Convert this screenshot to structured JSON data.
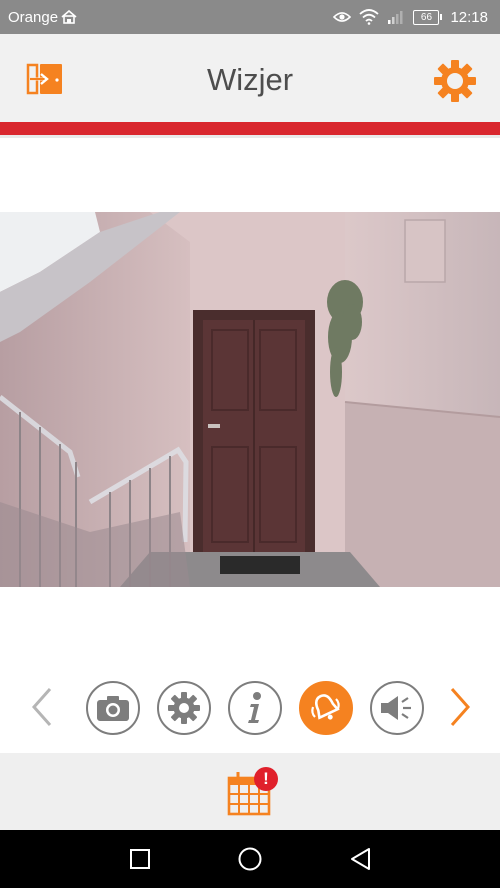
{
  "status_bar": {
    "carrier": "Orange",
    "battery": "66",
    "time": "12:18"
  },
  "app_bar": {
    "title": "Wizjer",
    "exit_icon": "exit-door-icon",
    "settings_icon": "gear-icon"
  },
  "camera_view": {
    "description_icon": "camera-feed"
  },
  "toolbar": {
    "buttons": [
      {
        "name": "snapshot",
        "icon": "camera-icon",
        "active": false
      },
      {
        "name": "settings",
        "icon": "gear-icon",
        "active": false
      },
      {
        "name": "info",
        "icon": "info-icon",
        "active": false
      },
      {
        "name": "bell",
        "icon": "bell-icon",
        "active": true
      },
      {
        "name": "speaker",
        "icon": "speaker-icon",
        "active": false
      }
    ]
  },
  "calendar": {
    "icon": "calendar-icon",
    "badge": "!"
  },
  "colors": {
    "accent": "#f58220",
    "red": "#d9272e",
    "statusbar": "#8a8a8a"
  }
}
